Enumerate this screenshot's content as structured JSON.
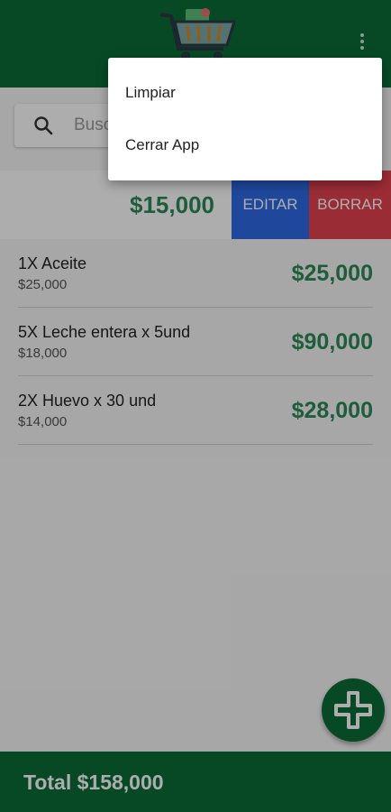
{
  "header": {
    "logo_icon": "shopping-cart-icon",
    "menu_icon": "more-vertical-icon",
    "brand_color": "#0b6c37"
  },
  "search": {
    "placeholder": "Buscar",
    "icon": "search-icon"
  },
  "swiped_item": {
    "total": "$15,000",
    "edit_label": "EDITAR",
    "delete_label": "BORRAR",
    "edit_color": "#2f6be6",
    "delete_color": "#e3424f"
  },
  "items": [
    {
      "name": "1X Aceite",
      "unit_price": "$25,000",
      "total": "$25,000"
    },
    {
      "name": "5X Leche entera x 5und",
      "unit_price": "$18,000",
      "total": "$90,000"
    },
    {
      "name": "2X Huevo x 30 und",
      "unit_price": "$14,000",
      "total": "$28,000"
    }
  ],
  "fab": {
    "icon": "plus-icon"
  },
  "footer": {
    "total_label": "Total $158,000"
  },
  "menu": {
    "items": [
      "Limpiar",
      "Cerrar App"
    ]
  }
}
